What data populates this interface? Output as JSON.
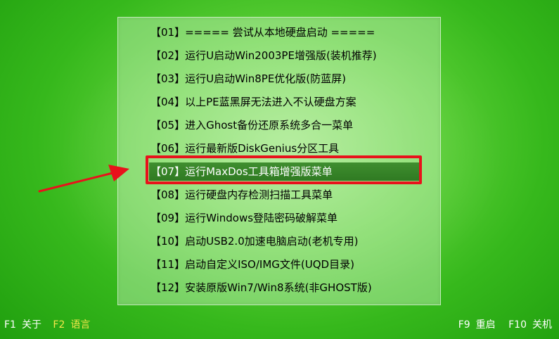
{
  "menu": {
    "items": [
      {
        "label": "【01】===== 尝试从本地硬盘启动 ====="
      },
      {
        "label": "【02】运行U启动Win2003PE增强版(装机推荐)"
      },
      {
        "label": "【03】运行U启动Win8PE优化版(防蓝屏)"
      },
      {
        "label": "【04】以上PE蓝黑屏无法进入不认硬盘方案"
      },
      {
        "label": "【05】进入Ghost备份还原系统多合一菜单"
      },
      {
        "label": "【06】运行最新版DiskGenius分区工具"
      },
      {
        "label": "【07】运行MaxDos工具箱增强版菜单"
      },
      {
        "label": "【08】运行硬盘内存检测扫描工具菜单"
      },
      {
        "label": "【09】运行Windows登陆密码破解菜单"
      },
      {
        "label": "【10】启动USB2.0加速电脑启动(老机专用)"
      },
      {
        "label": "【11】启动自定义ISO/IMG文件(UQD目录)"
      },
      {
        "label": "【12】安装原版Win7/Win8系统(非GHOST版)"
      }
    ],
    "selected_index": 6
  },
  "footer": {
    "left": [
      {
        "key": "F1",
        "label": "关于"
      },
      {
        "key": "F2",
        "label": "语言"
      }
    ],
    "right": [
      {
        "key": "F9",
        "label": "重启"
      },
      {
        "key": "F10",
        "label": "关机"
      }
    ]
  },
  "colors": {
    "background": "#36b81c",
    "selected_bar": "#2f7a22",
    "highlight_box": "#e8121b",
    "arrow": "#e8121b",
    "footer_text": "#ffffff",
    "footer_language": "#f4e64a"
  }
}
